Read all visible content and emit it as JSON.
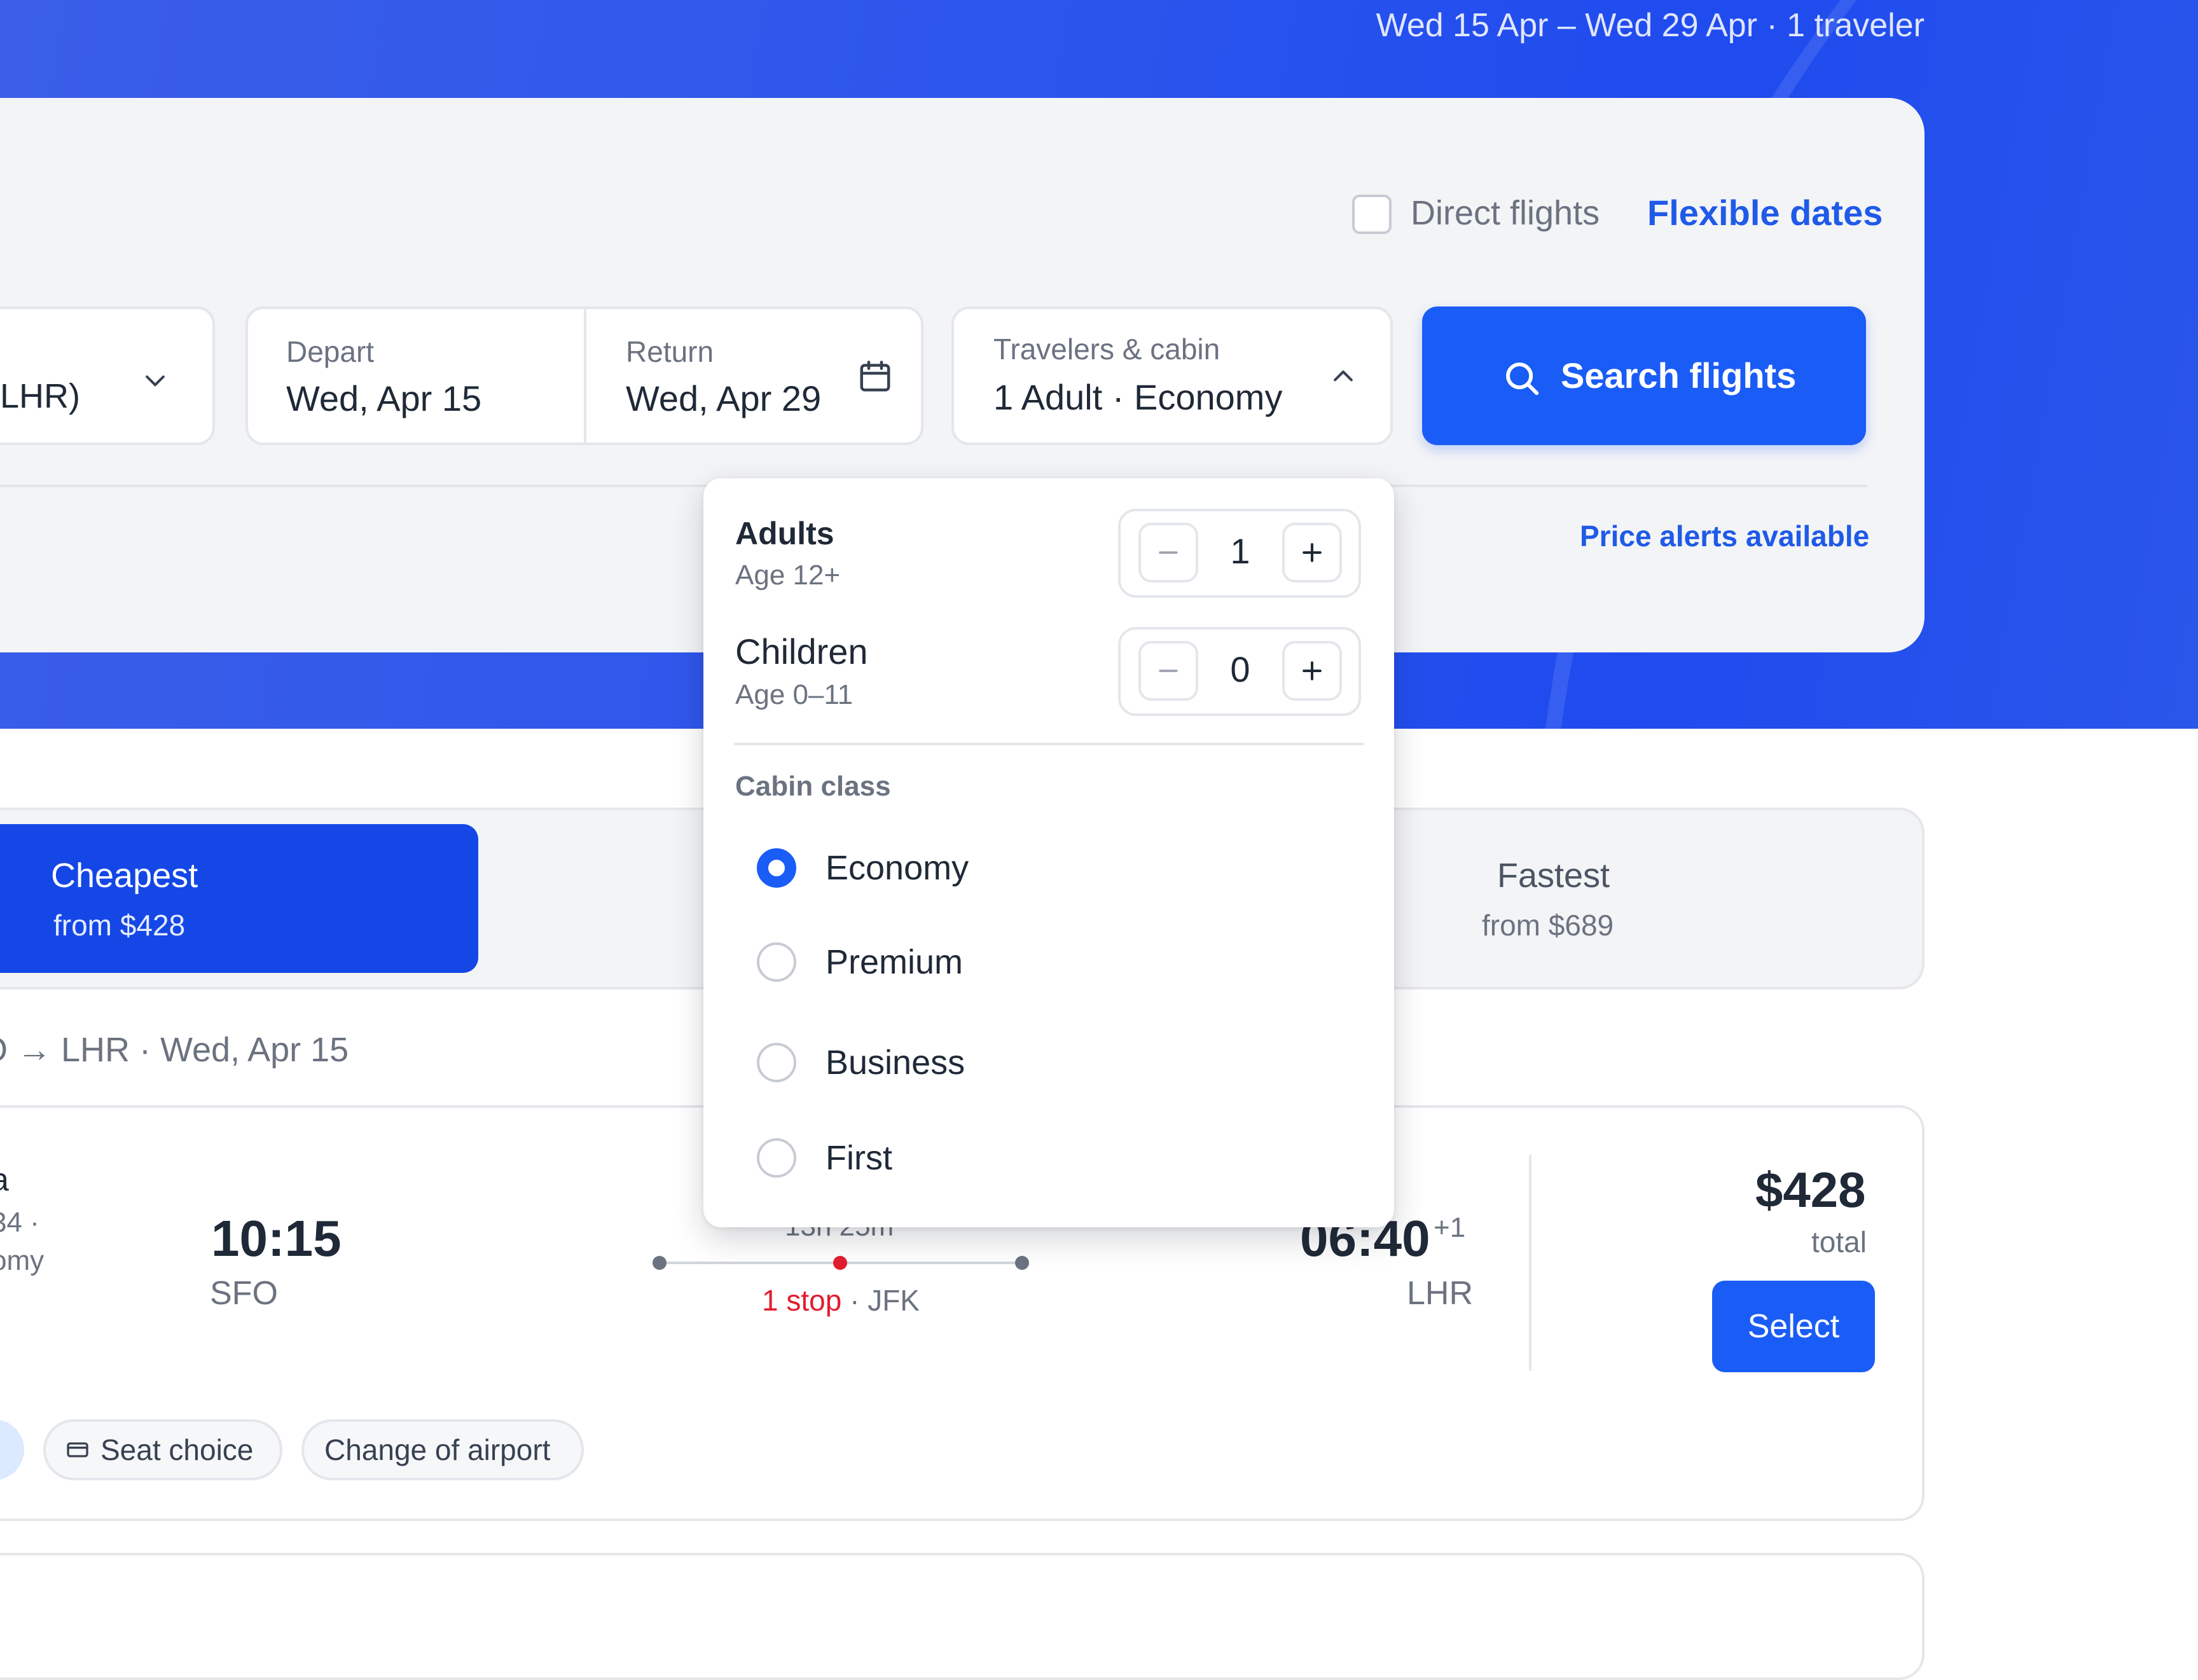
{
  "header": {
    "trip_summary": "Wed 15 Apr – Wed 29 Apr · 1 traveler"
  },
  "search": {
    "direct_flights_label": "Direct flights",
    "direct_flights_checked": false,
    "flexible_dates_label": "Flexible dates",
    "origin_value": "LHR)",
    "depart_label": "Depart",
    "depart_value": "Wed, Apr 15",
    "return_label": "Return",
    "return_value": "Wed, Apr 29",
    "travelers_label": "Travelers & cabin",
    "travelers_value": "1 Adult · Economy",
    "search_button": "Search flights",
    "price_alerts": "Price alerts available"
  },
  "travelers_dropdown": {
    "adults_label": "Adults",
    "adults_age": "Age 12+",
    "adults_count": "1",
    "children_label": "Children",
    "children_age": "Age 0–11",
    "children_count": "0",
    "cabin_heading": "Cabin class",
    "cabin_options": [
      "Economy",
      "Premium",
      "Business",
      "First"
    ],
    "cabin_selected": "Economy"
  },
  "sort_tabs": {
    "cheapest_label": "Cheapest",
    "cheapest_from": "from $428",
    "fastest_label": "Fastest",
    "fastest_from": "from $689"
  },
  "results": {
    "route_line": "O → LHR · Wed, Apr 15",
    "flight": {
      "airline_fragment": "a",
      "flight_fragment": "34 ·",
      "cabin_fragment": "omy",
      "depart_time": "10:15",
      "depart_code": "SFO",
      "duration": "13h 25m",
      "stops": "1 stop",
      "stop_airport": "· JFK",
      "arrive_time": "06:40",
      "arrive_day_offset": "+1",
      "arrive_code": "LHR",
      "price": "$428",
      "price_note": "total",
      "select_button": "Select",
      "chips": [
        "Seat choice",
        "Change of airport"
      ]
    }
  },
  "colors": {
    "brand_blue": "#1a5cf6",
    "link_blue": "#1f5ae8",
    "stop_red": "#e11d2e"
  }
}
